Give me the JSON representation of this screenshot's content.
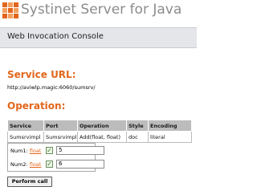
{
  "app": {
    "title": "Systinet Server for Java"
  },
  "console": {
    "title": "Web Invocation Console"
  },
  "service": {
    "heading": "Service URL:",
    "url": "http://aviwlp.magic:6060/sumsrv/"
  },
  "operation": {
    "heading": "Operation:",
    "columns": [
      "Service",
      "Port",
      "Operation",
      "Style",
      "Encoding"
    ],
    "row": [
      "Sumsrvimpl",
      "Sumsrvimpl",
      "Add(float, float)",
      "doc",
      "literal"
    ]
  },
  "params": [
    {
      "label": "Num1:",
      "type": "float",
      "checked": true,
      "value": "5"
    },
    {
      "label": "Num2:",
      "type": "float",
      "checked": true,
      "value": "6"
    }
  ],
  "actions": {
    "perform_label": "Perform call"
  },
  "colors": {
    "accent": "#e2661b",
    "header_bar": "#e4e6ea",
    "table_header": "#bcbcbc"
  }
}
